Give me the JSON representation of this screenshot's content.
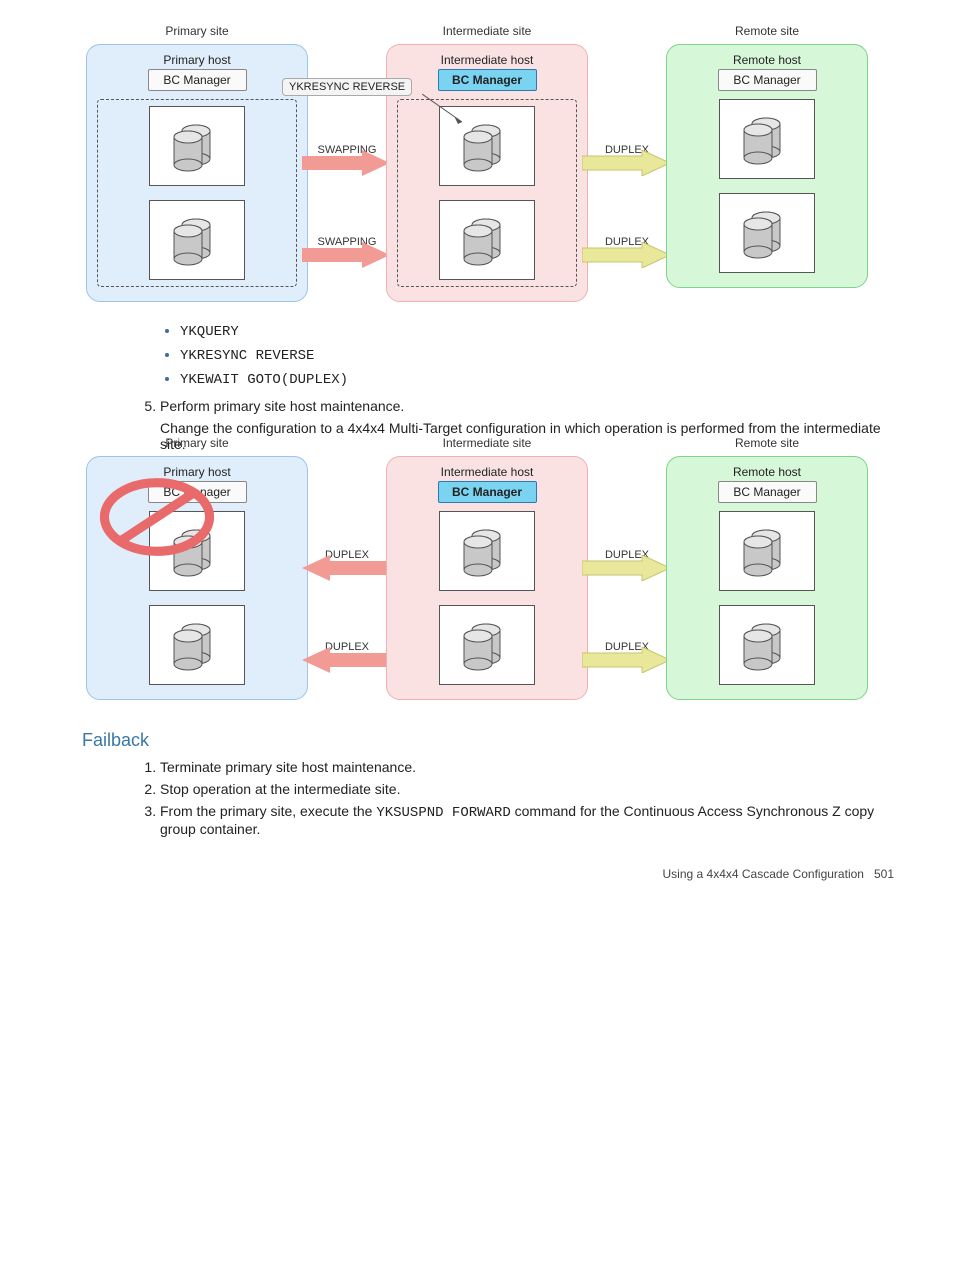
{
  "diagram1": {
    "callout": "YKRESYNC REVERSE",
    "sites": {
      "primary": {
        "label": "Primary site",
        "host": "Primary host",
        "bcm": "BC Manager",
        "active": false
      },
      "intermediate": {
        "label": "Intermediate site",
        "host": "Intermediate host",
        "bcm": "BC Manager",
        "active": true
      },
      "remote": {
        "label": "Remote site",
        "host": "Remote host",
        "bcm": "BC Manager",
        "active": false
      }
    },
    "arrows_left": [
      "SWAPPING",
      "SWAPPING"
    ],
    "arrows_right": [
      "DUPLEX",
      "DUPLEX"
    ]
  },
  "commands": [
    "YKQUERY",
    "YKRESYNC REVERSE",
    "YKEWAIT GOTO(DUPLEX)"
  ],
  "step5": {
    "title": "Perform primary site host maintenance.",
    "body": "Change the configuration to a 4x4x4 Multi-Target configuration in which operation is performed from the intermediate site."
  },
  "diagram2": {
    "sites": {
      "primary": {
        "label": "Primary site",
        "host": "Primary host",
        "bcm": "BC Manager",
        "active": false,
        "prohibited": true
      },
      "intermediate": {
        "label": "Intermediate site",
        "host": "Intermediate host",
        "bcm": "BC Manager",
        "active": true
      },
      "remote": {
        "label": "Remote site",
        "host": "Remote host",
        "bcm": "BC Manager",
        "active": false
      }
    },
    "arrows_left": [
      "DUPLEX",
      "DUPLEX"
    ],
    "arrows_right": [
      "DUPLEX",
      "DUPLEX"
    ]
  },
  "failback": {
    "heading": "Failback",
    "steps": [
      "Terminate primary site host maintenance.",
      "Stop operation at the intermediate site.",
      "From the primary site, execute the YKSUSPND FORWARD command for the Continuous Access Synchronous Z copy group container."
    ],
    "step3_prefix": "From the primary site, execute the ",
    "step3_cmd": "YKSUSPND FORWARD",
    "step3_suffix": " command for the Continuous Access Synchronous Z copy group container."
  },
  "footer": {
    "text": "Using a 4x4x4 Cascade Configuration",
    "page": "501"
  }
}
